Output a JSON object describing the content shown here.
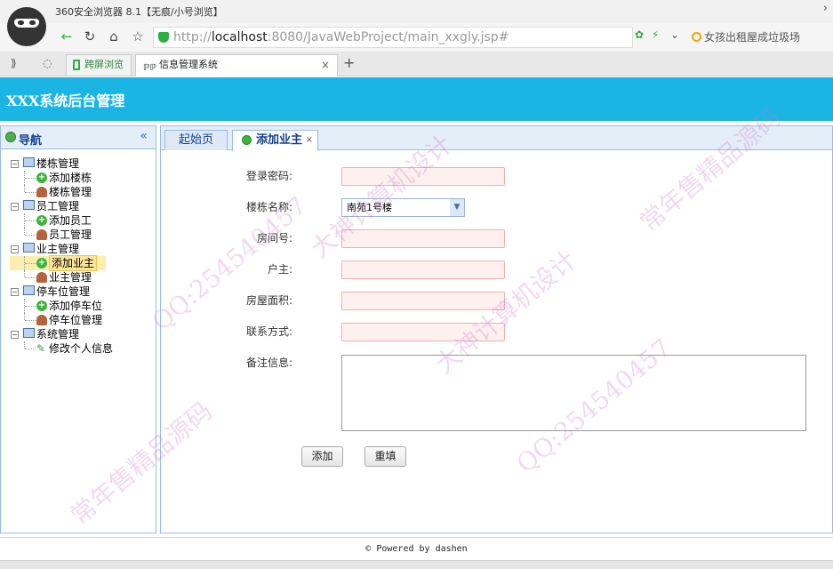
{
  "browser": {
    "window_title": "360安全浏览器 8.1【无痕/小号浏览】",
    "url_scheme": "http://",
    "url_host": "localhost",
    "url_rest": ":8080/JavaWebProject/main_xxgly.jsp#",
    "search_text": "女孩出租屋成垃圾场",
    "tabs": [
      {
        "label": "跨屏浏览"
      },
      {
        "label": "信息管理系统"
      }
    ]
  },
  "app": {
    "header_title": "XXX系统后台管理"
  },
  "nav": {
    "title": "导航",
    "collapse_glyph": "«",
    "groups": [
      {
        "label": "楼栋管理",
        "items": [
          {
            "label": "添加楼栋",
            "icon": "add-icon"
          },
          {
            "label": "楼栋管理",
            "icon": "user-icon"
          }
        ]
      },
      {
        "label": "员工管理",
        "items": [
          {
            "label": "添加员工",
            "icon": "add-icon"
          },
          {
            "label": "员工管理",
            "icon": "user-icon"
          }
        ]
      },
      {
        "label": "业主管理",
        "items": [
          {
            "label": "添加业主",
            "icon": "add-icon"
          },
          {
            "label": "业主管理",
            "icon": "user-icon"
          }
        ]
      },
      {
        "label": "停车位管理",
        "items": [
          {
            "label": "添加停车位",
            "icon": "add-icon"
          },
          {
            "label": "停车位管理",
            "icon": "user-icon"
          }
        ]
      },
      {
        "label": "系统管理",
        "items": [
          {
            "label": "修改个人信息",
            "icon": "pencil-icon"
          }
        ]
      }
    ],
    "selected": "添加业主"
  },
  "content": {
    "tabs": [
      {
        "label": "起始页"
      },
      {
        "label": "添加业主"
      }
    ],
    "form": {
      "fields": [
        {
          "label": "登录密码:",
          "value": ""
        },
        {
          "label": "楼栋名称:",
          "value": "南苑1号楼"
        },
        {
          "label": "房间号:",
          "value": ""
        },
        {
          "label": "户主:",
          "value": ""
        },
        {
          "label": "房屋面积:",
          "value": ""
        },
        {
          "label": "联系方式:",
          "value": ""
        },
        {
          "label": "备注信息:",
          "value": ""
        }
      ],
      "add_button": "添加",
      "reset_button": "重填"
    }
  },
  "footer": {
    "text": "© Powered by dashen"
  },
  "watermark": {
    "lines": [
      "常年售精品源码",
      "QQ:254540457",
      "大神计算机设计"
    ]
  }
}
